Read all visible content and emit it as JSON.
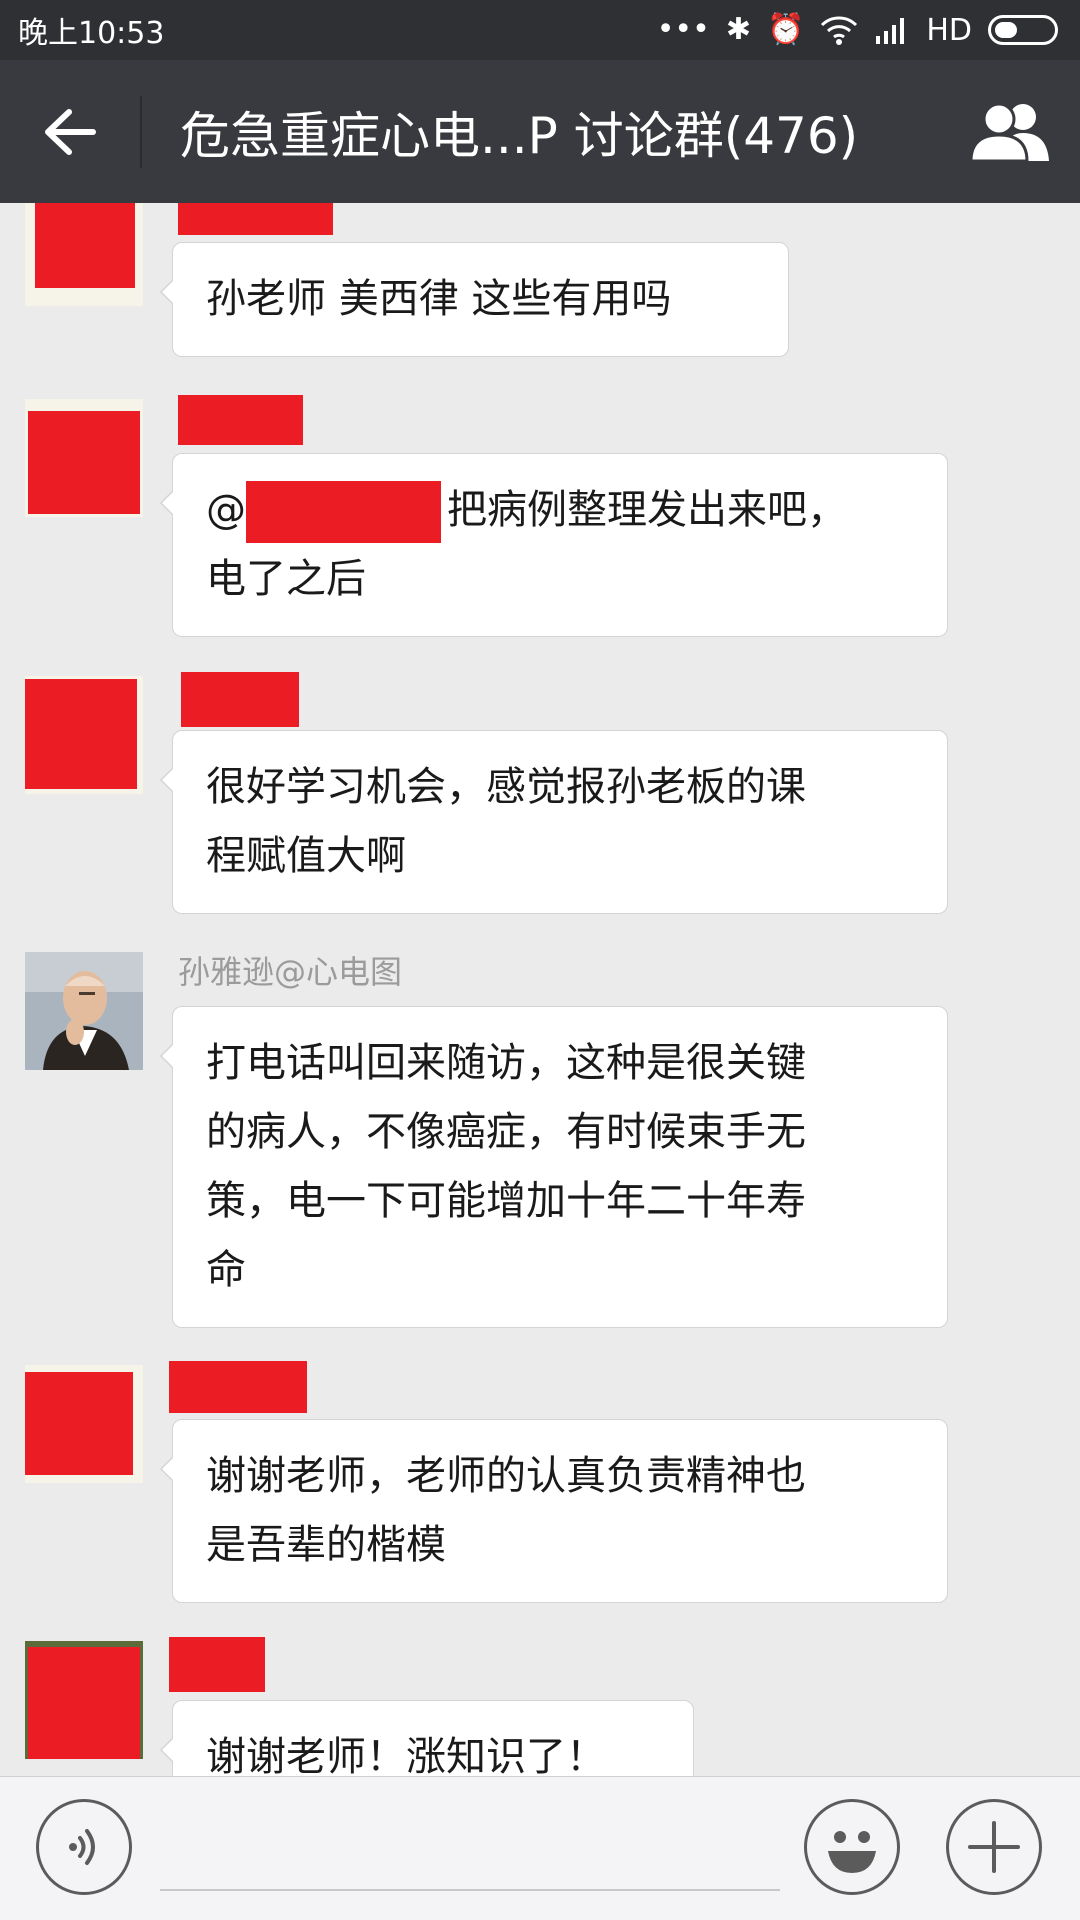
{
  "status_bar": {
    "time": "晚上10:53",
    "dots": "•••",
    "bluetooth": "✱",
    "alarm": "⏰",
    "network": "HD",
    "icons": [
      "bluetooth-icon",
      "alarm-icon",
      "wifi-icon",
      "signal-icon",
      "battery-icon"
    ]
  },
  "header": {
    "title": "危急重症心电...P 讨论群(476)",
    "back_icon": "back-arrow-icon",
    "members_icon": "group-members-icon"
  },
  "messages": [
    {
      "sender": "",
      "sender_redacted": true,
      "text": "孙老师 美西律 这些有用吗"
    },
    {
      "sender": "",
      "sender_redacted": true,
      "mention_prefix": "@",
      "mention_redacted": true,
      "text_after_mention": "把病例整理发出来吧，",
      "text_line2": "电了之后"
    },
    {
      "sender": "",
      "sender_redacted": true,
      "text_line1": "很好学习机会，感觉报孙老板的课",
      "text_line2": "程赋值大啊"
    },
    {
      "sender": "孙雅逊@心电图",
      "sender_redacted": false,
      "avatar": "teacher-photo",
      "text_line1": "打电话叫回来随访，这种是很关键",
      "text_line2": "的病人，不像癌症，有时候束手无",
      "text_line3": "策，电一下可能增加十年二十年寿",
      "text_line4": "命"
    },
    {
      "sender": "",
      "sender_redacted": true,
      "text_line1": "谢谢老师，老师的认真负责精神也",
      "text_line2": "是吾辈的楷模"
    },
    {
      "sender": "",
      "sender_redacted": true,
      "text": "谢谢老师！涨知识了！"
    }
  ],
  "redaction_color": "#ec1c24",
  "input_bar": {
    "voice_icon": "voice-icon",
    "emoji_icon": "emoji-icon",
    "plus_icon": "plus-icon",
    "placeholder": ""
  }
}
